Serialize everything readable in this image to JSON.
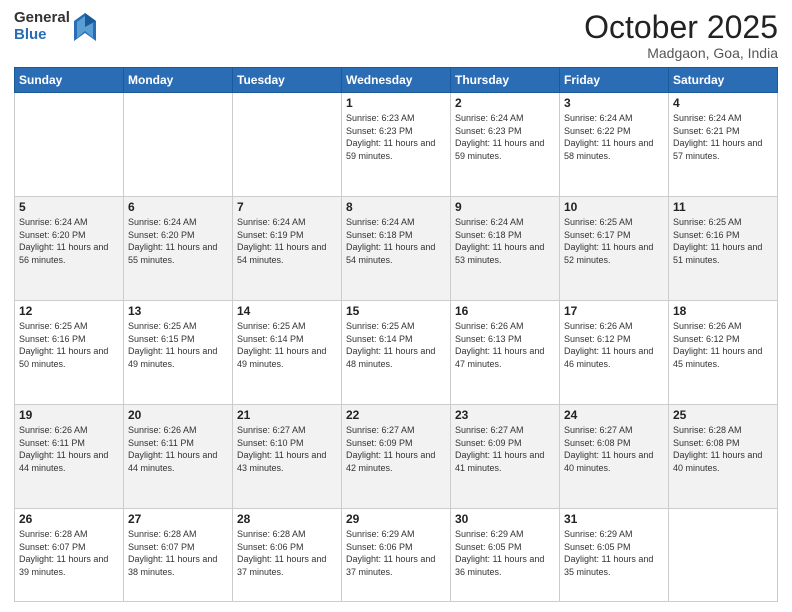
{
  "header": {
    "logo_general": "General",
    "logo_blue": "Blue",
    "month_title": "October 2025",
    "location": "Madgaon, Goa, India"
  },
  "weekdays": [
    "Sunday",
    "Monday",
    "Tuesday",
    "Wednesday",
    "Thursday",
    "Friday",
    "Saturday"
  ],
  "weeks": [
    [
      {
        "day": "",
        "sunrise": "",
        "sunset": "",
        "daylight": ""
      },
      {
        "day": "",
        "sunrise": "",
        "sunset": "",
        "daylight": ""
      },
      {
        "day": "",
        "sunrise": "",
        "sunset": "",
        "daylight": ""
      },
      {
        "day": "1",
        "sunrise": "Sunrise: 6:23 AM",
        "sunset": "Sunset: 6:23 PM",
        "daylight": "Daylight: 11 hours and 59 minutes."
      },
      {
        "day": "2",
        "sunrise": "Sunrise: 6:24 AM",
        "sunset": "Sunset: 6:23 PM",
        "daylight": "Daylight: 11 hours and 59 minutes."
      },
      {
        "day": "3",
        "sunrise": "Sunrise: 6:24 AM",
        "sunset": "Sunset: 6:22 PM",
        "daylight": "Daylight: 11 hours and 58 minutes."
      },
      {
        "day": "4",
        "sunrise": "Sunrise: 6:24 AM",
        "sunset": "Sunset: 6:21 PM",
        "daylight": "Daylight: 11 hours and 57 minutes."
      }
    ],
    [
      {
        "day": "5",
        "sunrise": "Sunrise: 6:24 AM",
        "sunset": "Sunset: 6:20 PM",
        "daylight": "Daylight: 11 hours and 56 minutes."
      },
      {
        "day": "6",
        "sunrise": "Sunrise: 6:24 AM",
        "sunset": "Sunset: 6:20 PM",
        "daylight": "Daylight: 11 hours and 55 minutes."
      },
      {
        "day": "7",
        "sunrise": "Sunrise: 6:24 AM",
        "sunset": "Sunset: 6:19 PM",
        "daylight": "Daylight: 11 hours and 54 minutes."
      },
      {
        "day": "8",
        "sunrise": "Sunrise: 6:24 AM",
        "sunset": "Sunset: 6:18 PM",
        "daylight": "Daylight: 11 hours and 54 minutes."
      },
      {
        "day": "9",
        "sunrise": "Sunrise: 6:24 AM",
        "sunset": "Sunset: 6:18 PM",
        "daylight": "Daylight: 11 hours and 53 minutes."
      },
      {
        "day": "10",
        "sunrise": "Sunrise: 6:25 AM",
        "sunset": "Sunset: 6:17 PM",
        "daylight": "Daylight: 11 hours and 52 minutes."
      },
      {
        "day": "11",
        "sunrise": "Sunrise: 6:25 AM",
        "sunset": "Sunset: 6:16 PM",
        "daylight": "Daylight: 11 hours and 51 minutes."
      }
    ],
    [
      {
        "day": "12",
        "sunrise": "Sunrise: 6:25 AM",
        "sunset": "Sunset: 6:16 PM",
        "daylight": "Daylight: 11 hours and 50 minutes."
      },
      {
        "day": "13",
        "sunrise": "Sunrise: 6:25 AM",
        "sunset": "Sunset: 6:15 PM",
        "daylight": "Daylight: 11 hours and 49 minutes."
      },
      {
        "day": "14",
        "sunrise": "Sunrise: 6:25 AM",
        "sunset": "Sunset: 6:14 PM",
        "daylight": "Daylight: 11 hours and 49 minutes."
      },
      {
        "day": "15",
        "sunrise": "Sunrise: 6:25 AM",
        "sunset": "Sunset: 6:14 PM",
        "daylight": "Daylight: 11 hours and 48 minutes."
      },
      {
        "day": "16",
        "sunrise": "Sunrise: 6:26 AM",
        "sunset": "Sunset: 6:13 PM",
        "daylight": "Daylight: 11 hours and 47 minutes."
      },
      {
        "day": "17",
        "sunrise": "Sunrise: 6:26 AM",
        "sunset": "Sunset: 6:12 PM",
        "daylight": "Daylight: 11 hours and 46 minutes."
      },
      {
        "day": "18",
        "sunrise": "Sunrise: 6:26 AM",
        "sunset": "Sunset: 6:12 PM",
        "daylight": "Daylight: 11 hours and 45 minutes."
      }
    ],
    [
      {
        "day": "19",
        "sunrise": "Sunrise: 6:26 AM",
        "sunset": "Sunset: 6:11 PM",
        "daylight": "Daylight: 11 hours and 44 minutes."
      },
      {
        "day": "20",
        "sunrise": "Sunrise: 6:26 AM",
        "sunset": "Sunset: 6:11 PM",
        "daylight": "Daylight: 11 hours and 44 minutes."
      },
      {
        "day": "21",
        "sunrise": "Sunrise: 6:27 AM",
        "sunset": "Sunset: 6:10 PM",
        "daylight": "Daylight: 11 hours and 43 minutes."
      },
      {
        "day": "22",
        "sunrise": "Sunrise: 6:27 AM",
        "sunset": "Sunset: 6:09 PM",
        "daylight": "Daylight: 11 hours and 42 minutes."
      },
      {
        "day": "23",
        "sunrise": "Sunrise: 6:27 AM",
        "sunset": "Sunset: 6:09 PM",
        "daylight": "Daylight: 11 hours and 41 minutes."
      },
      {
        "day": "24",
        "sunrise": "Sunrise: 6:27 AM",
        "sunset": "Sunset: 6:08 PM",
        "daylight": "Daylight: 11 hours and 40 minutes."
      },
      {
        "day": "25",
        "sunrise": "Sunrise: 6:28 AM",
        "sunset": "Sunset: 6:08 PM",
        "daylight": "Daylight: 11 hours and 40 minutes."
      }
    ],
    [
      {
        "day": "26",
        "sunrise": "Sunrise: 6:28 AM",
        "sunset": "Sunset: 6:07 PM",
        "daylight": "Daylight: 11 hours and 39 minutes."
      },
      {
        "day": "27",
        "sunrise": "Sunrise: 6:28 AM",
        "sunset": "Sunset: 6:07 PM",
        "daylight": "Daylight: 11 hours and 38 minutes."
      },
      {
        "day": "28",
        "sunrise": "Sunrise: 6:28 AM",
        "sunset": "Sunset: 6:06 PM",
        "daylight": "Daylight: 11 hours and 37 minutes."
      },
      {
        "day": "29",
        "sunrise": "Sunrise: 6:29 AM",
        "sunset": "Sunset: 6:06 PM",
        "daylight": "Daylight: 11 hours and 37 minutes."
      },
      {
        "day": "30",
        "sunrise": "Sunrise: 6:29 AM",
        "sunset": "Sunset: 6:05 PM",
        "daylight": "Daylight: 11 hours and 36 minutes."
      },
      {
        "day": "31",
        "sunrise": "Sunrise: 6:29 AM",
        "sunset": "Sunset: 6:05 PM",
        "daylight": "Daylight: 11 hours and 35 minutes."
      },
      {
        "day": "",
        "sunrise": "",
        "sunset": "",
        "daylight": ""
      }
    ]
  ]
}
